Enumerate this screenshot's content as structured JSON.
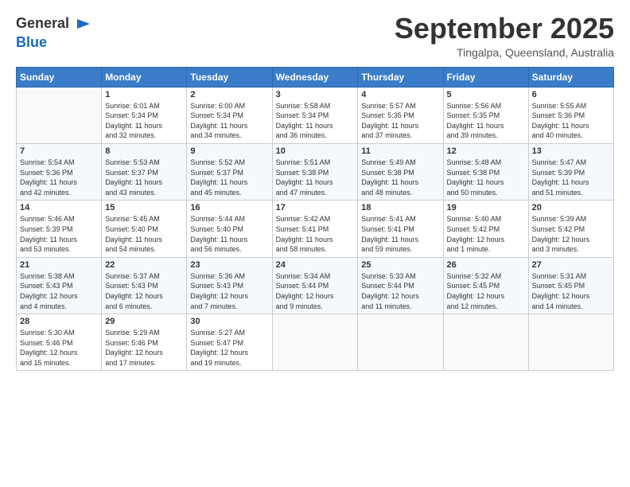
{
  "header": {
    "logo_general": "General",
    "logo_blue": "Blue",
    "month": "September 2025",
    "location": "Tingalpa, Queensland, Australia"
  },
  "days_of_week": [
    "Sunday",
    "Monday",
    "Tuesday",
    "Wednesday",
    "Thursday",
    "Friday",
    "Saturday"
  ],
  "weeks": [
    [
      {
        "day": "",
        "info": ""
      },
      {
        "day": "1",
        "info": "Sunrise: 6:01 AM\nSunset: 5:34 PM\nDaylight: 11 hours\nand 32 minutes."
      },
      {
        "day": "2",
        "info": "Sunrise: 6:00 AM\nSunset: 5:34 PM\nDaylight: 11 hours\nand 34 minutes."
      },
      {
        "day": "3",
        "info": "Sunrise: 5:58 AM\nSunset: 5:34 PM\nDaylight: 11 hours\nand 36 minutes."
      },
      {
        "day": "4",
        "info": "Sunrise: 5:57 AM\nSunset: 5:35 PM\nDaylight: 11 hours\nand 37 minutes."
      },
      {
        "day": "5",
        "info": "Sunrise: 5:56 AM\nSunset: 5:35 PM\nDaylight: 11 hours\nand 39 minutes."
      },
      {
        "day": "6",
        "info": "Sunrise: 5:55 AM\nSunset: 5:36 PM\nDaylight: 11 hours\nand 40 minutes."
      }
    ],
    [
      {
        "day": "7",
        "info": "Sunrise: 5:54 AM\nSunset: 5:36 PM\nDaylight: 11 hours\nand 42 minutes."
      },
      {
        "day": "8",
        "info": "Sunrise: 5:53 AM\nSunset: 5:37 PM\nDaylight: 11 hours\nand 43 minutes."
      },
      {
        "day": "9",
        "info": "Sunrise: 5:52 AM\nSunset: 5:37 PM\nDaylight: 11 hours\nand 45 minutes."
      },
      {
        "day": "10",
        "info": "Sunrise: 5:51 AM\nSunset: 5:38 PM\nDaylight: 11 hours\nand 47 minutes."
      },
      {
        "day": "11",
        "info": "Sunrise: 5:49 AM\nSunset: 5:38 PM\nDaylight: 11 hours\nand 48 minutes."
      },
      {
        "day": "12",
        "info": "Sunrise: 5:48 AM\nSunset: 5:38 PM\nDaylight: 11 hours\nand 50 minutes."
      },
      {
        "day": "13",
        "info": "Sunrise: 5:47 AM\nSunset: 5:39 PM\nDaylight: 11 hours\nand 51 minutes."
      }
    ],
    [
      {
        "day": "14",
        "info": "Sunrise: 5:46 AM\nSunset: 5:39 PM\nDaylight: 11 hours\nand 53 minutes."
      },
      {
        "day": "15",
        "info": "Sunrise: 5:45 AM\nSunset: 5:40 PM\nDaylight: 11 hours\nand 54 minutes."
      },
      {
        "day": "16",
        "info": "Sunrise: 5:44 AM\nSunset: 5:40 PM\nDaylight: 11 hours\nand 56 minutes."
      },
      {
        "day": "17",
        "info": "Sunrise: 5:42 AM\nSunset: 5:41 PM\nDaylight: 11 hours\nand 58 minutes."
      },
      {
        "day": "18",
        "info": "Sunrise: 5:41 AM\nSunset: 5:41 PM\nDaylight: 11 hours\nand 59 minutes."
      },
      {
        "day": "19",
        "info": "Sunrise: 5:40 AM\nSunset: 5:42 PM\nDaylight: 12 hours\nand 1 minute."
      },
      {
        "day": "20",
        "info": "Sunrise: 5:39 AM\nSunset: 5:42 PM\nDaylight: 12 hours\nand 3 minutes."
      }
    ],
    [
      {
        "day": "21",
        "info": "Sunrise: 5:38 AM\nSunset: 5:43 PM\nDaylight: 12 hours\nand 4 minutes."
      },
      {
        "day": "22",
        "info": "Sunrise: 5:37 AM\nSunset: 5:43 PM\nDaylight: 12 hours\nand 6 minutes."
      },
      {
        "day": "23",
        "info": "Sunrise: 5:36 AM\nSunset: 5:43 PM\nDaylight: 12 hours\nand 7 minutes."
      },
      {
        "day": "24",
        "info": "Sunrise: 5:34 AM\nSunset: 5:44 PM\nDaylight: 12 hours\nand 9 minutes."
      },
      {
        "day": "25",
        "info": "Sunrise: 5:33 AM\nSunset: 5:44 PM\nDaylight: 12 hours\nand 11 minutes."
      },
      {
        "day": "26",
        "info": "Sunrise: 5:32 AM\nSunset: 5:45 PM\nDaylight: 12 hours\nand 12 minutes."
      },
      {
        "day": "27",
        "info": "Sunrise: 5:31 AM\nSunset: 5:45 PM\nDaylight: 12 hours\nand 14 minutes."
      }
    ],
    [
      {
        "day": "28",
        "info": "Sunrise: 5:30 AM\nSunset: 5:46 PM\nDaylight: 12 hours\nand 15 minutes."
      },
      {
        "day": "29",
        "info": "Sunrise: 5:29 AM\nSunset: 5:46 PM\nDaylight: 12 hours\nand 17 minutes."
      },
      {
        "day": "30",
        "info": "Sunrise: 5:27 AM\nSunset: 5:47 PM\nDaylight: 12 hours\nand 19 minutes."
      },
      {
        "day": "",
        "info": ""
      },
      {
        "day": "",
        "info": ""
      },
      {
        "day": "",
        "info": ""
      },
      {
        "day": "",
        "info": ""
      }
    ]
  ]
}
